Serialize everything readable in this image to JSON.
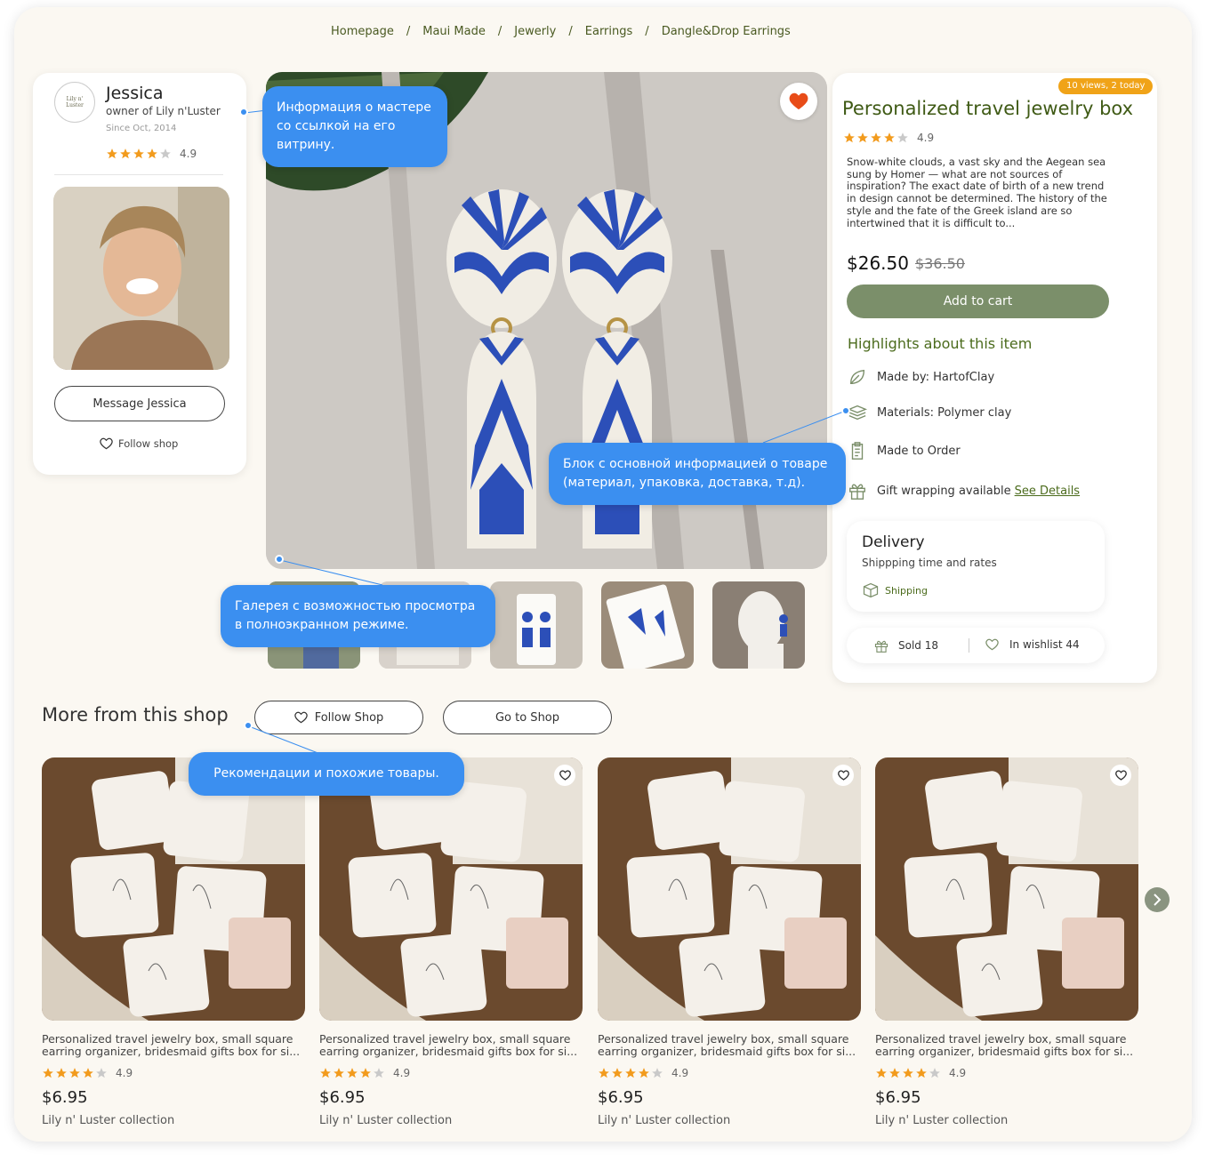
{
  "breadcrumb": [
    "Homepage",
    "Maui Made",
    "Jewerly",
    "Earrings",
    "Dangle&Drop Earrings"
  ],
  "seller": {
    "name": "Jessica",
    "role": "owner of Lily n'Luster",
    "since": "Since Oct, 2014",
    "rating": "4.9",
    "rating_value": 4,
    "message_label": "Message Jessica",
    "follow_label": "Follow shop",
    "logo_text": "Lily n' Luster"
  },
  "product": {
    "views_badge": "10 views, 2 today",
    "title": "Personalized travel jewelry box",
    "rating": "4.9",
    "description": "Snow-white clouds, a vast sky and the Aegean sea sung by Homer — what are not sources of inspiration? The exact date of birth of a new trend in design cannot be determined. The history of the style and the fate of the Greek island are so intertwined that it is difficult to...",
    "price": "$26.50",
    "old_price": "$36.50",
    "add_to_cart": "Add to cart",
    "highlights_title": "Highlights about this item",
    "highlights": [
      {
        "icon": "leaf-icon",
        "text": "Made by: HartofClay"
      },
      {
        "icon": "layers-icon",
        "text": "Materials: Polymer clay"
      },
      {
        "icon": "clipboard-icon",
        "text": "Made to Order"
      },
      {
        "icon": "gift-icon",
        "text": "Gift wrapping available",
        "link": "See Details"
      }
    ],
    "delivery": {
      "title": "Delivery",
      "subtitle": "Shippping time and rates",
      "link": "Shipping"
    },
    "sold": "Sold 18",
    "wishlist": "In wishlist 44"
  },
  "annotations": {
    "master": "Информация о мастере со ссылкой на его витрину.",
    "block": "Блок с основной информацией о товаре (материал, упаковка, доставка, т.д).",
    "gallery": "Галерея с возможностью просмотра в полноэкранном режиме.",
    "recs": "Рекомендации и похожие товары."
  },
  "more": {
    "title": "More from this shop",
    "follow_label": "Follow Shop",
    "go_label": "Go to Shop",
    "items": [
      {
        "title": "Personalized travel jewelry box, small square earring organizer, bridesmaid gifts box for si...",
        "rating": "4.9",
        "price": "$6.95",
        "shop": "Lily n' Luster collection"
      },
      {
        "title": "Personalized travel jewelry box, small square earring organizer, bridesmaid gifts box for si...",
        "rating": "4.9",
        "price": "$6.95",
        "shop": "Lily n' Luster collection"
      },
      {
        "title": "Personalized travel jewelry box, small square earring organizer, bridesmaid gifts box for si...",
        "rating": "4.9",
        "price": "$6.95",
        "shop": "Lily n' Luster collection"
      },
      {
        "title": "Personalized travel jewelry box, small square earring organizer, bridesmaid gifts box for si...",
        "rating": "4.9",
        "price": "$6.95",
        "shop": "Lily n' Luster collection"
      }
    ]
  },
  "colors": {
    "accent_green": "#7b8f6a",
    "heading_green": "#4b6b1c",
    "star": "#f29b1d",
    "annotation": "#3b8ff0",
    "badge": "#f0a318"
  }
}
